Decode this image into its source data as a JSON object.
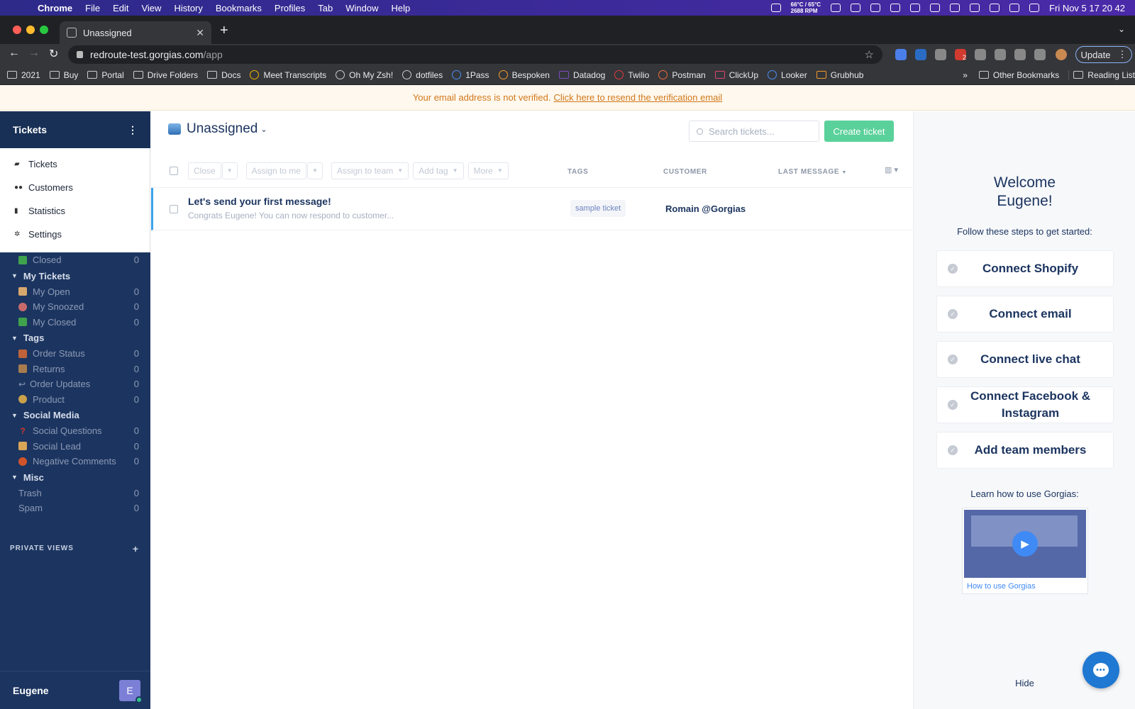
{
  "os_menubar": {
    "app": "Chrome",
    "menus": [
      "File",
      "Edit",
      "View",
      "History",
      "Bookmarks",
      "Profiles",
      "Tab",
      "Window",
      "Help"
    ],
    "temp_line1": "66°C / 65°C",
    "temp_line2": "2688 RPM",
    "clock": "Fri Nov 5  17 20 42"
  },
  "browser": {
    "tab_title": "Unassigned",
    "url_host": "redroute-test.gorgias.com",
    "url_path": "/app",
    "update_label": "Update",
    "extension_badge": "2",
    "bookmarks": [
      {
        "label": "2021",
        "icon": "folder-icon"
      },
      {
        "label": "Buy",
        "icon": "folder-icon"
      },
      {
        "label": "Portal",
        "icon": "folder-icon"
      },
      {
        "label": "Drive Folders",
        "icon": "folder-icon"
      },
      {
        "label": "Docs",
        "icon": "folder-icon"
      },
      {
        "label": "Meet Transcripts",
        "icon": "drive-icon"
      },
      {
        "label": "Oh My Zsh!",
        "icon": "github-icon"
      },
      {
        "label": "dotfiles",
        "icon": "github-icon"
      },
      {
        "label": "1Pass",
        "icon": "onepassword-icon"
      },
      {
        "label": "Bespoken",
        "icon": "bespoken-icon"
      },
      {
        "label": "Datadog",
        "icon": "datadog-icon"
      },
      {
        "label": "Twilio",
        "icon": "twilio-icon"
      },
      {
        "label": "Postman",
        "icon": "postman-icon"
      },
      {
        "label": "ClickUp",
        "icon": "clickup-icon"
      },
      {
        "label": "Looker",
        "icon": "looker-icon"
      },
      {
        "label": "Grubhub",
        "icon": "grubhub-icon"
      }
    ],
    "more_bookmarks": "»",
    "other_bookmarks": "Other Bookmarks",
    "reading_list": "Reading List"
  },
  "banner": {
    "text": "Your email address is not verified.",
    "link": "Click here to resend the verification email"
  },
  "sidebar": {
    "title": "Tickets",
    "menu": [
      {
        "label": "Tickets",
        "icon": "tickets-icon"
      },
      {
        "label": "Customers",
        "icon": "customers-icon"
      },
      {
        "label": "Statistics",
        "icon": "statistics-icon"
      },
      {
        "label": "Settings",
        "icon": "settings-icon"
      }
    ],
    "closed_view": {
      "label": "Closed",
      "count": "0"
    },
    "sections": [
      {
        "title": "My Tickets",
        "items": [
          {
            "label": "My Open",
            "count": "0",
            "icon": "hand-icon",
            "color": "#d7a86e"
          },
          {
            "label": "My Snoozed",
            "count": "0",
            "icon": "alarm-icon",
            "color": "#c86a6a"
          },
          {
            "label": "My Closed",
            "count": "0",
            "icon": "check-icon",
            "color": "#3fa34d"
          }
        ]
      },
      {
        "title": "Tags",
        "items": [
          {
            "label": "Order Status",
            "count": "0",
            "icon": "truck-icon",
            "color": "#c0633a"
          },
          {
            "label": "Returns",
            "count": "0",
            "icon": "package-icon",
            "color": "#a87b4f"
          },
          {
            "label": "Order Updates",
            "count": "0",
            "icon": "return-arrow-icon",
            "color": "#8d9ab5"
          },
          {
            "label": "Product",
            "count": "0",
            "icon": "moneybag-icon",
            "color": "#c9a14a"
          }
        ]
      },
      {
        "title": "Social Media",
        "items": [
          {
            "label": "Social Questions",
            "count": "0",
            "icon": "question-icon",
            "color": "#d0392b"
          },
          {
            "label": "Social Lead",
            "count": "0",
            "icon": "handshake-icon",
            "color": "#d8a657"
          },
          {
            "label": "Negative Comments",
            "count": "0",
            "icon": "angry-face-icon",
            "color": "#d0542b"
          }
        ]
      },
      {
        "title": "Misc",
        "items": [
          {
            "label": "Trash",
            "count": "0"
          },
          {
            "label": "Spam",
            "count": "0"
          }
        ]
      }
    ],
    "private_views": "PRIVATE VIEWS",
    "user_name": "Eugene",
    "avatar_initial": "E"
  },
  "main": {
    "view_title": "Unassigned",
    "search_placeholder": "Search tickets...",
    "create_label": "Create ticket",
    "actions": {
      "close": "Close",
      "assign_me": "Assign to me",
      "assign_team": "Assign to team",
      "add_tag": "Add tag",
      "more": "More"
    },
    "columns": {
      "tags": "TAGS",
      "customer": "CUSTOMER",
      "last_message": "LAST MESSAGE"
    },
    "tickets": [
      {
        "subject": "Let's send your first message!",
        "excerpt": "Congrats Eugene! You can now respond to customer...",
        "tag": "sample ticket",
        "customer": "Romain @Gorgias"
      }
    ]
  },
  "onboarding": {
    "welcome_line1": "Welcome",
    "welcome_line2": "Eugene!",
    "steps_label": "Follow these steps to get started:",
    "steps": [
      {
        "label": "Connect Shopify"
      },
      {
        "label": "Connect email"
      },
      {
        "label": "Connect live chat"
      },
      {
        "label": "Connect Facebook & Instagram"
      },
      {
        "label": "Add team members"
      }
    ],
    "learn_label": "Learn how to use Gorgias:",
    "video_label": "How to use Gorgias",
    "hide_label": "Hide"
  }
}
